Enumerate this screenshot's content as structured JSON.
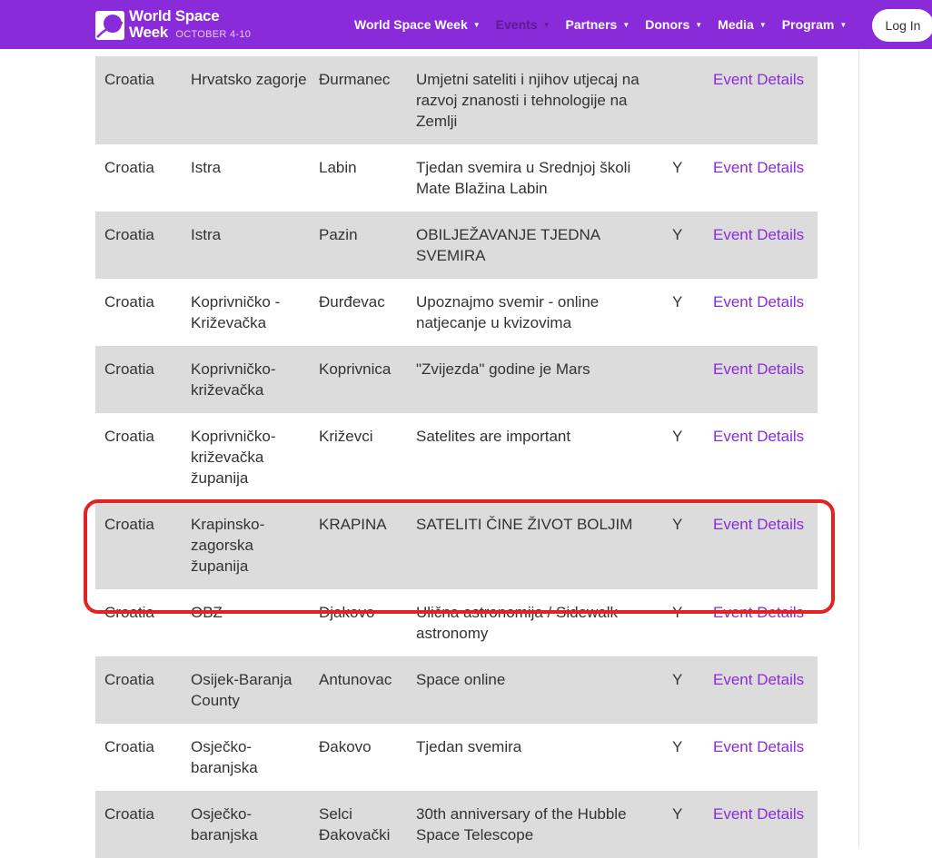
{
  "header": {
    "logo_line1": "World Space",
    "logo_week": "Week",
    "logo_dates": "OCTOBER 4-10",
    "nav": [
      {
        "label": "World Space Week"
      },
      {
        "label": "Events"
      },
      {
        "label": "Partners"
      },
      {
        "label": "Donors"
      },
      {
        "label": "Media"
      },
      {
        "label": "Program"
      }
    ],
    "login_label": "Log In"
  },
  "colors": {
    "brand_purple": "#8a2bd9",
    "row_shade": "#dcdcdc",
    "highlight_red": "#e32222"
  },
  "table": {
    "rows": [
      {
        "country": "Croatia",
        "region": "Hrvatsko zagorje",
        "city": "Đurmanec",
        "title": "Umjetni sateliti i njihov utjecaj na razvoj znanosti i tehnologije na Zemlji",
        "flag": "",
        "link": "Event Details"
      },
      {
        "country": "Croatia",
        "region": "Istra",
        "city": "Labin",
        "title": "Tjedan svemira u Srednjoj školi Mate Blažina Labin",
        "flag": "Y",
        "link": "Event Details"
      },
      {
        "country": "Croatia",
        "region": "Istra",
        "city": "Pazin",
        "title": "OBILJEŽAVANJE TJEDNA SVEMIRA",
        "flag": "Y",
        "link": "Event Details"
      },
      {
        "country": "Croatia",
        "region": "Koprivničko - Križevačka",
        "city": "Đurđevac",
        "title": "Upoznajmo svemir - online natjecanje u kvizovima",
        "flag": "Y",
        "link": "Event Details"
      },
      {
        "country": "Croatia",
        "region": "Koprivničko-križevačka",
        "city": "Koprivnica",
        "title": "\"Zvijezda\" godine je Mars",
        "flag": "",
        "link": "Event Details"
      },
      {
        "country": "Croatia",
        "region": "Koprivničko-križevačka županija",
        "city": "Križevci",
        "title": "Satelites are important",
        "flag": "Y",
        "link": "Event Details"
      },
      {
        "country": "Croatia",
        "region": "Krapinsko-zagorska županija",
        "city": "KRAPINA",
        "title": "SATELITI ČINE ŽIVOT BOLJIM",
        "flag": "Y",
        "link": "Event Details"
      },
      {
        "country": "Croatia",
        "region": "OBZ",
        "city": "Djakovo",
        "title": "Ulična astronomija / Sidewalk astronomy",
        "flag": "Y",
        "link": "Event Details"
      },
      {
        "country": "Croatia",
        "region": "Osijek-Baranja County",
        "city": "Antunovac",
        "title": "Space online",
        "flag": "Y",
        "link": "Event Details"
      },
      {
        "country": "Croatia",
        "region": "Osječko-baranjska",
        "city": "Đakovo",
        "title": "Tjedan svemira",
        "flag": "Y",
        "link": "Event Details"
      },
      {
        "country": "Croatia",
        "region": "Osječko-baranjska",
        "city": "Selci Đakovački",
        "title": "30th anniversary of the Hubble Space Telescope",
        "flag": "Y",
        "link": "Event Details"
      }
    ]
  }
}
